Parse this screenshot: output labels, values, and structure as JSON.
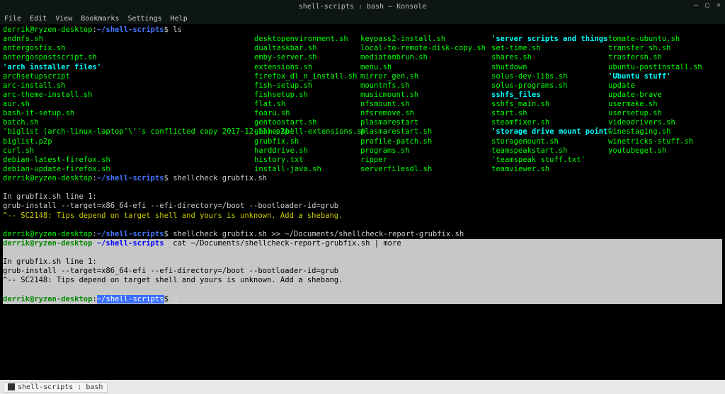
{
  "titlebar": {
    "title": "shell-scripts : bash — Konsole"
  },
  "menu": [
    "File",
    "Edit",
    "View",
    "Bookmarks",
    "Settings",
    "Help"
  ],
  "prompt": {
    "user_host": "derrik@ryzen-desktop",
    "path": "~/shell-scripts",
    "dollar": "$"
  },
  "cmd": {
    "ls": "ls",
    "sc1": "shellcheck grubfix.sh",
    "sc2": "shellcheck grubfix.sh >> ~/Documents/shellcheck-report-grubfix.sh",
    "cat": "cat ~/Documents/shellcheck-report-grubfix.sh | more"
  },
  "file_rows": [
    [
      {
        "t": "andnfs.sh",
        "c": "green"
      },
      {
        "t": "desktopenvironment.sh",
        "c": "green"
      },
      {
        "t": "keypass2-install.sh",
        "c": "green"
      },
      {
        "t": "'server scripts and things'",
        "c": "cyan"
      },
      {
        "t": "tomate-ubuntu.sh",
        "c": "green"
      }
    ],
    [
      {
        "t": "antergosfix.sh",
        "c": "green"
      },
      {
        "t": "dualtaskbar.sh",
        "c": "green"
      },
      {
        "t": "local-to-remote-disk-copy.sh",
        "c": "green"
      },
      {
        "t": "set-time.sh",
        "c": "green"
      },
      {
        "t": "transfer_sh.sh",
        "c": "green"
      }
    ],
    [
      {
        "t": "antergospostscript.sh",
        "c": "green"
      },
      {
        "t": "emby-server.sh",
        "c": "green"
      },
      {
        "t": "mediatombrun.sh",
        "c": "green"
      },
      {
        "t": "shares.sh",
        "c": "green"
      },
      {
        "t": "trasfersh.sh",
        "c": "green"
      }
    ],
    [
      {
        "t": "'arch installer files'",
        "c": "cyan"
      },
      {
        "t": "extensions.sh",
        "c": "green"
      },
      {
        "t": "menu.sh",
        "c": "green"
      },
      {
        "t": "shutdown",
        "c": "green"
      },
      {
        "t": "ubuntu-postinstall.sh",
        "c": "green"
      }
    ],
    [
      {
        "t": "archsetupscript",
        "c": "green"
      },
      {
        "t": "firefox_dl_n_install.sh",
        "c": "green"
      },
      {
        "t": "mirror_gen.sh",
        "c": "green"
      },
      {
        "t": "solus-dev-libs.sh",
        "c": "green"
      },
      {
        "t": "'Ubuntu stuff'",
        "c": "cyan"
      }
    ],
    [
      {
        "t": "arc-install.sh",
        "c": "green"
      },
      {
        "t": "fish-setup.sh",
        "c": "green"
      },
      {
        "t": "mountnfs.sh",
        "c": "green"
      },
      {
        "t": "solus-programs.sh",
        "c": "green"
      },
      {
        "t": "update",
        "c": "green"
      }
    ],
    [
      {
        "t": "arc-theme-install.sh",
        "c": "green"
      },
      {
        "t": "fishsetup.sh",
        "c": "green"
      },
      {
        "t": "musicmount.sh",
        "c": "green"
      },
      {
        "t": "sshfs_files",
        "c": "cyan"
      },
      {
        "t": "update-brave",
        "c": "green"
      }
    ],
    [
      {
        "t": "aur.sh",
        "c": "green"
      },
      {
        "t": "flat.sh",
        "c": "green"
      },
      {
        "t": "nfsmount.sh",
        "c": "green"
      },
      {
        "t": "sshfs_main.sh",
        "c": "green"
      },
      {
        "t": "usermake.sh",
        "c": "green"
      }
    ],
    [
      {
        "t": "bash-it-setup.sh",
        "c": "green"
      },
      {
        "t": "foaru.sh",
        "c": "green"
      },
      {
        "t": "nfsremove.sh",
        "c": "green"
      },
      {
        "t": "start.sh",
        "c": "green"
      },
      {
        "t": "usersetup.sh",
        "c": "green"
      }
    ],
    [
      {
        "t": "batch.sh",
        "c": "green"
      },
      {
        "t": "gentoostart.sh",
        "c": "green"
      },
      {
        "t": "plasmarestart",
        "c": "green"
      },
      {
        "t": "steamfixer.sh",
        "c": "green"
      },
      {
        "t": "videodrivers.sh",
        "c": "green"
      }
    ],
    [
      {
        "t": "'biglist (arch-linux-laptop'\\''s conflicted copy 2017-12-11).p2p'",
        "c": "green"
      },
      {
        "t": "gnome-shell-extensions.sh",
        "c": "green"
      },
      {
        "t": "plasmarestart.sh",
        "c": "green"
      },
      {
        "t": "'storage drive mount point'",
        "c": "cyan"
      },
      {
        "t": "winestaging.sh",
        "c": "green"
      }
    ],
    [
      {
        "t": "biglist.p2p",
        "c": "green"
      },
      {
        "t": "grubfix.sh",
        "c": "green"
      },
      {
        "t": "profile-patch.sh",
        "c": "green"
      },
      {
        "t": "storagemount.sh",
        "c": "green"
      },
      {
        "t": "winetricks-stuff.sh",
        "c": "green"
      }
    ],
    [
      {
        "t": "curl.sh",
        "c": "green"
      },
      {
        "t": "harddrive.sh",
        "c": "green"
      },
      {
        "t": "programs.sh",
        "c": "green"
      },
      {
        "t": "teamspeakstart.sh",
        "c": "green"
      },
      {
        "t": "youtubeget.sh",
        "c": "green"
      }
    ],
    [
      {
        "t": "debian-latest-firefox.sh",
        "c": "green"
      },
      {
        "t": "history.txt",
        "c": "green"
      },
      {
        "t": "ripper",
        "c": "green"
      },
      {
        "t": "'teamspeak stuff.txt'",
        "c": "green"
      },
      {
        "t": "",
        "c": "green"
      }
    ],
    [
      {
        "t": "debian-update-firefox.sh",
        "c": "green"
      },
      {
        "t": "install-java.sh",
        "c": "green"
      },
      {
        "t": "serverfilesdl.sh",
        "c": "green"
      },
      {
        "t": "teamviewer.sh",
        "c": "green"
      },
      {
        "t": "",
        "c": "green"
      }
    ]
  ],
  "sc_out": {
    "line1": "In grubfix.sh line 1:",
    "line2": "grub-install --target=x86_64-efi --efi-directory=/boot --bootloader-id=grub",
    "line3": "^-- SC2148: Tips depend on target shell and yours is unknown. Add a shebang.",
    "line3b": "^-- SC2148: Tips depend on target shell and yours is unknown. Add a shebang."
  },
  "taskbar": {
    "label": "shell-scripts : bash"
  }
}
